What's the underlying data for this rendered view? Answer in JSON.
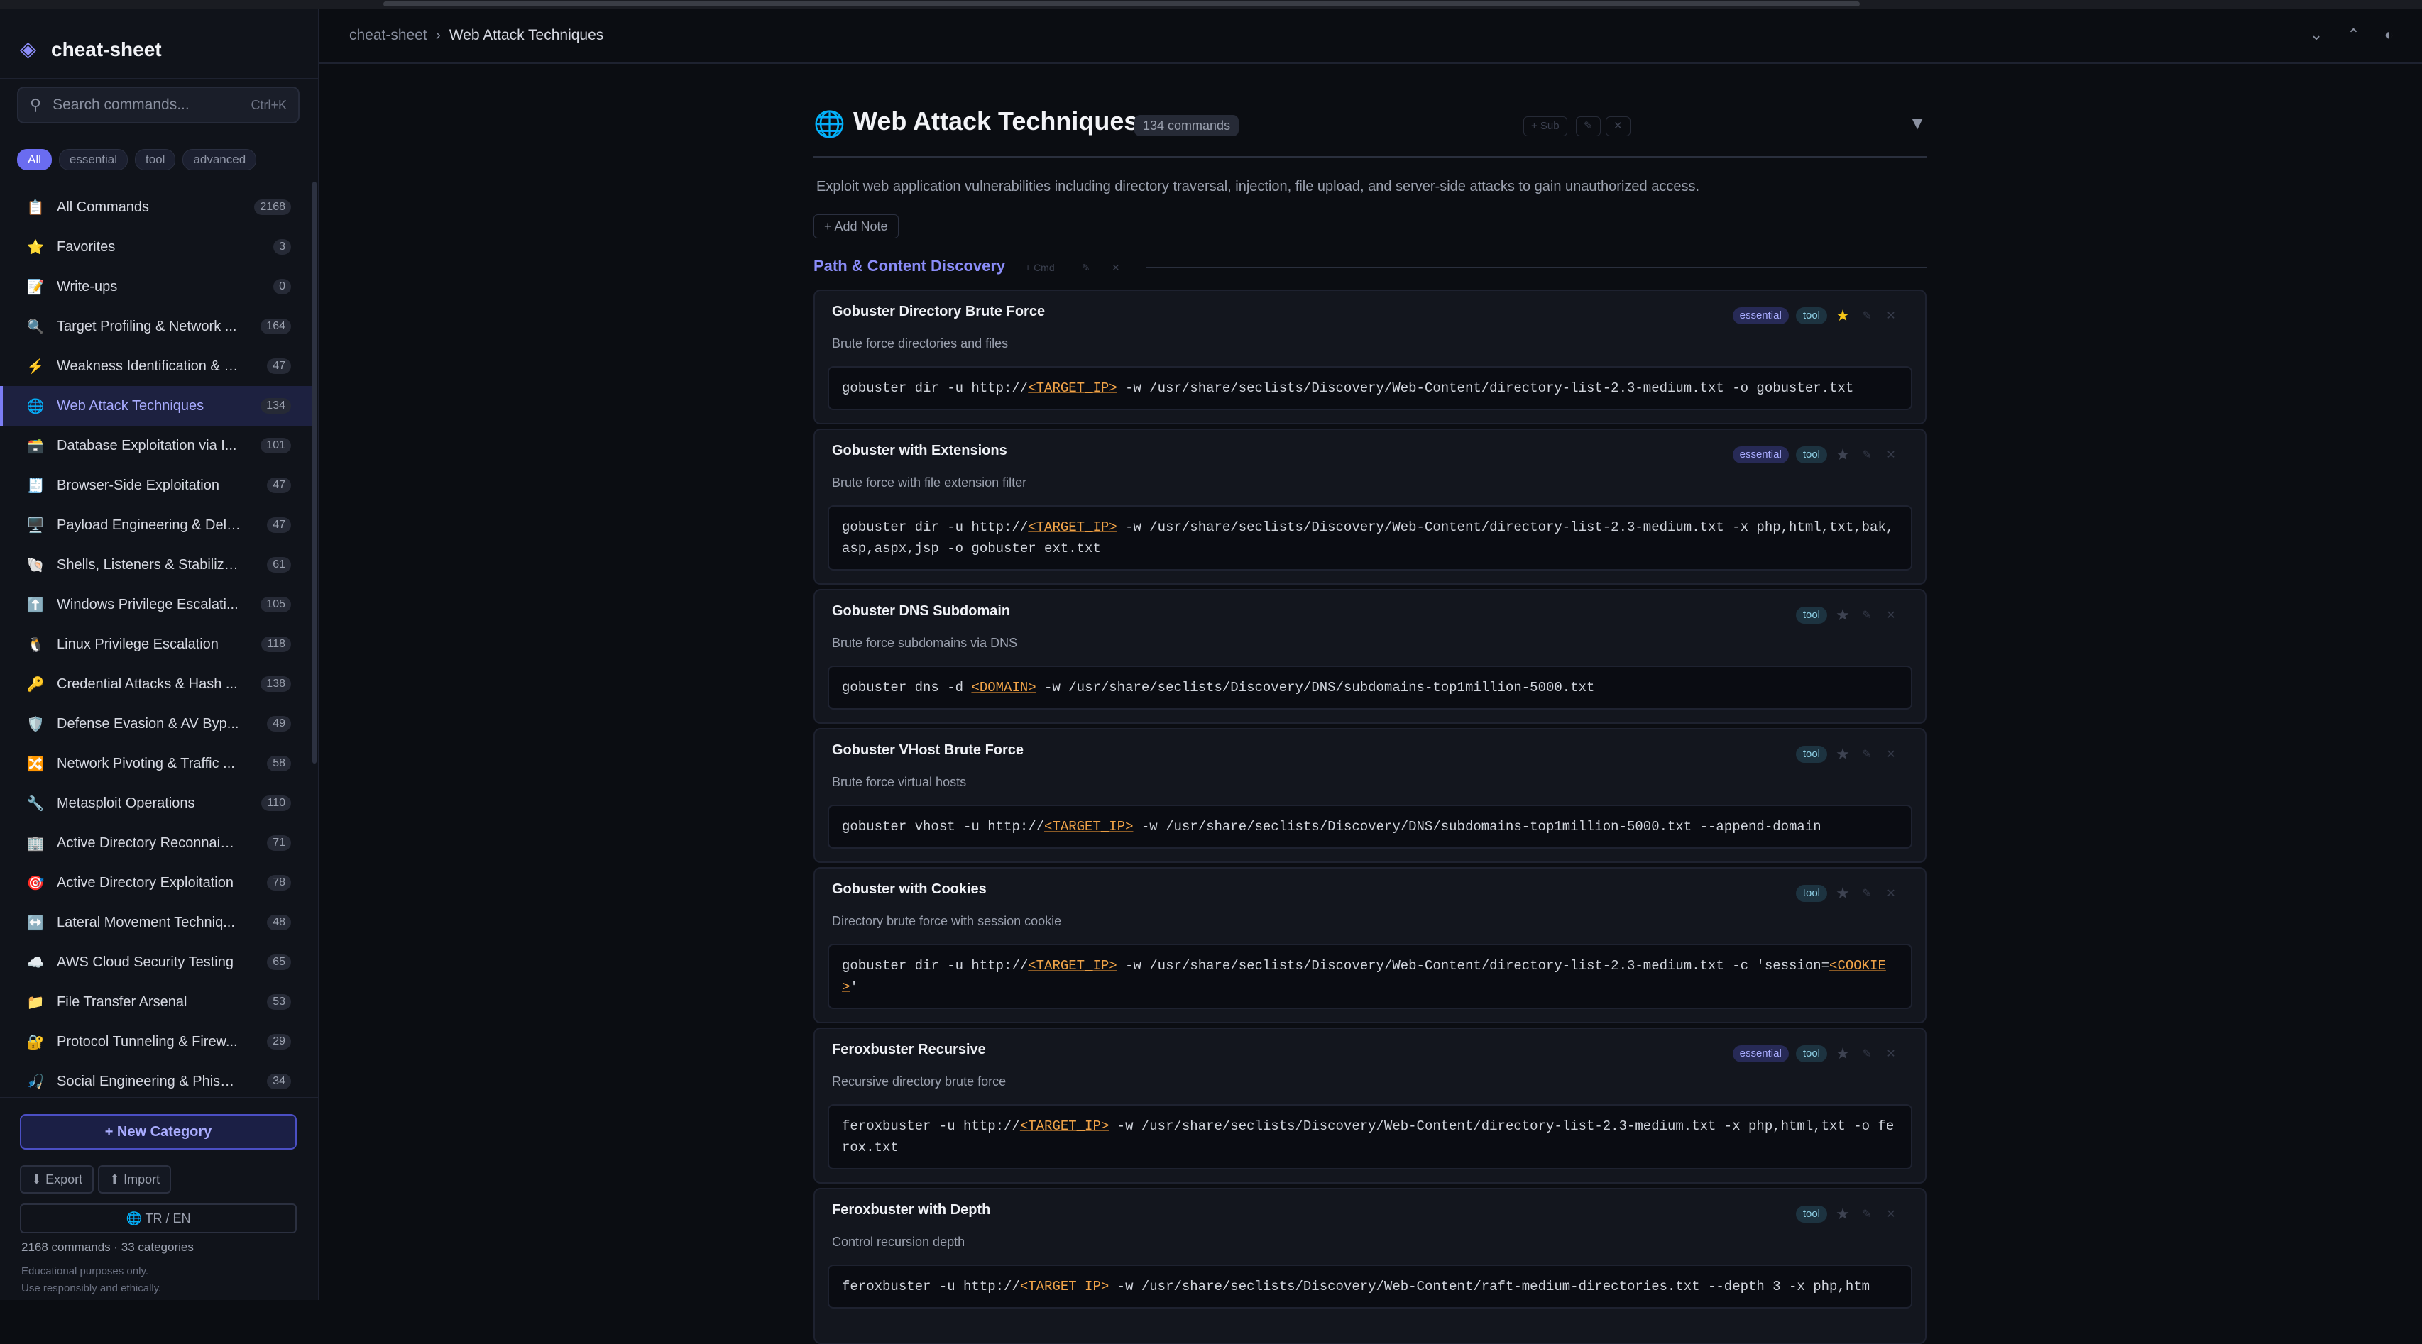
{
  "app": {
    "name": "cheat-sheet"
  },
  "search": {
    "placeholder": "Search commands...",
    "shortcut": "Ctrl+K"
  },
  "filters": [
    "All",
    "essential",
    "tool",
    "advanced"
  ],
  "sidebar": {
    "items": [
      {
        "icon": "📋",
        "label": "All Commands",
        "count": "2168"
      },
      {
        "icon": "⭐",
        "label": "Favorites",
        "count": "3"
      },
      {
        "icon": "📝",
        "label": "Write-ups",
        "count": "0"
      },
      {
        "icon": "🔍",
        "label": "Target Profiling & Network ...",
        "count": "164"
      },
      {
        "icon": "⚡",
        "label": "Weakness Identification & S...",
        "count": "47"
      },
      {
        "icon": "🌐",
        "label": "Web Attack Techniques",
        "count": "134"
      },
      {
        "icon": "🗃️",
        "label": "Database Exploitation via I...",
        "count": "101"
      },
      {
        "icon": "🧾",
        "label": "Browser-Side Exploitation",
        "count": "47"
      },
      {
        "icon": "🖥️",
        "label": "Payload Engineering & Deli...",
        "count": "47"
      },
      {
        "icon": "🐚",
        "label": "Shells, Listeners & Stabilizat...",
        "count": "61"
      },
      {
        "icon": "⬆️",
        "label": "Windows Privilege Escalati...",
        "count": "105"
      },
      {
        "icon": "🐧",
        "label": "Linux Privilege Escalation",
        "count": "118"
      },
      {
        "icon": "🔑",
        "label": "Credential Attacks & Hash ...",
        "count": "138"
      },
      {
        "icon": "🛡️",
        "label": "Defense Evasion & AV Byp...",
        "count": "49"
      },
      {
        "icon": "🔀",
        "label": "Network Pivoting & Traffic ...",
        "count": "58"
      },
      {
        "icon": "🔧",
        "label": "Metasploit Operations",
        "count": "110"
      },
      {
        "icon": "🏢",
        "label": "Active Directory Reconnaiss...",
        "count": "71"
      },
      {
        "icon": "🎯",
        "label": "Active Directory Exploitation",
        "count": "78"
      },
      {
        "icon": "↔️",
        "label": "Lateral Movement Techniq...",
        "count": "48"
      },
      {
        "icon": "☁️",
        "label": "AWS Cloud Security Testing",
        "count": "65"
      },
      {
        "icon": "📁",
        "label": "File Transfer Arsenal",
        "count": "53"
      },
      {
        "icon": "🔐",
        "label": "Protocol Tunneling & Firew...",
        "count": "29"
      },
      {
        "icon": "🎣",
        "label": "Social Engineering & Phishi...",
        "count": "34"
      }
    ],
    "new_category": "+ New Category",
    "export": "⬇ Export",
    "import": "⬆ Import",
    "lang": "🌐 TR / EN",
    "stats": "2168 commands · 33 categories",
    "disclaimer1": "Educational purposes only.",
    "disclaimer2": "Use responsibly and ethically."
  },
  "breadcrumb": {
    "root": "cheat-sheet",
    "sep": "›",
    "current": "Web Attack Techniques"
  },
  "header_icons": [
    "⌄",
    "⌃",
    "◐"
  ],
  "page": {
    "icon": "🌐",
    "title": "Web Attack Techniques",
    "count": "134 commands",
    "ghost_sub": "+ Sub",
    "ghost_edit": "✎",
    "ghost_del": "✕",
    "collapse": "▼",
    "description": "Exploit web application vulnerabilities including directory traversal, injection, file upload, and server-side attacks to gain unauthorized access.",
    "add_note": "+ Add Note"
  },
  "section": {
    "title": "Path & Content Discovery",
    "ghost_cmd": "+ Cmd",
    "ghost_edit": "✎",
    "ghost_del": "✕"
  },
  "cards": [
    {
      "title": "Gobuster Directory Brute Force",
      "desc": "Brute force directories and files",
      "tags": [
        "essential",
        "tool"
      ],
      "fav": true,
      "code": [
        [
          "gobuster dir -u http://",
          "c"
        ],
        [
          "<TARGET_IP>",
          "p"
        ],
        [
          " -w /usr/share/seclists/Discovery/Web-Content/directory-list-2.3-medium.txt -o gobuster.txt",
          "c"
        ]
      ]
    },
    {
      "title": "Gobuster with Extensions",
      "desc": "Brute force with file extension filter",
      "tags": [
        "essential",
        "tool"
      ],
      "fav": false,
      "code": [
        [
          "gobuster dir -u http://",
          "c"
        ],
        [
          "<TARGET_IP>",
          "p"
        ],
        [
          " -w /usr/share/seclists/Discovery/Web-Content/directory-list-2.3-medium.txt -x php,html,txt,bak,asp,aspx,jsp -o gobuster_ext.txt",
          "c"
        ]
      ]
    },
    {
      "title": "Gobuster DNS Subdomain",
      "desc": "Brute force subdomains via DNS",
      "tags": [
        "tool"
      ],
      "fav": false,
      "code": [
        [
          "gobuster dns -d ",
          "c"
        ],
        [
          "<DOMAIN>",
          "p"
        ],
        [
          " -w /usr/share/seclists/Discovery/DNS/subdomains-top1million-5000.txt",
          "c"
        ]
      ]
    },
    {
      "title": "Gobuster VHost Brute Force",
      "desc": "Brute force virtual hosts",
      "tags": [
        "tool"
      ],
      "fav": false,
      "code": [
        [
          "gobuster vhost -u http://",
          "c"
        ],
        [
          "<TARGET_IP>",
          "p"
        ],
        [
          " -w /usr/share/seclists/Discovery/DNS/subdomains-top1million-5000.txt --append-domain",
          "c"
        ]
      ]
    },
    {
      "title": "Gobuster with Cookies",
      "desc": "Directory brute force with session cookie",
      "tags": [
        "tool"
      ],
      "fav": false,
      "code": [
        [
          "gobuster dir -u http://",
          "c"
        ],
        [
          "<TARGET_IP>",
          "p"
        ],
        [
          " -w /usr/share/seclists/Discovery/Web-Content/directory-list-2.3-medium.txt -c 'session=",
          "c"
        ],
        [
          "<COOKIE>",
          "p"
        ],
        [
          "'",
          "c"
        ]
      ]
    },
    {
      "title": "Feroxbuster Recursive",
      "desc": "Recursive directory brute force",
      "tags": [
        "essential",
        "tool"
      ],
      "fav": false,
      "code": [
        [
          "feroxbuster -u http://",
          "c"
        ],
        [
          "<TARGET_IP>",
          "p"
        ],
        [
          " -w /usr/share/seclists/Discovery/Web-Content/directory-list-2.3-medium.txt -x php,html,txt -o ferox.txt",
          "c"
        ]
      ]
    },
    {
      "title": "Feroxbuster with Depth",
      "desc": "Control recursion depth",
      "tags": [
        "tool"
      ],
      "fav": false,
      "code": [
        [
          "feroxbuster -u http://",
          "c"
        ],
        [
          "<TARGET_IP>",
          "p"
        ],
        [
          " -w /usr/share/seclists/Discovery/Web-Content/raft-medium-directories.txt --depth 3 -x php,htm",
          "c"
        ]
      ]
    }
  ],
  "colors": {
    "accent": "#7b7df5",
    "placeholder": "#f0a348",
    "background": "#0b0d12"
  }
}
